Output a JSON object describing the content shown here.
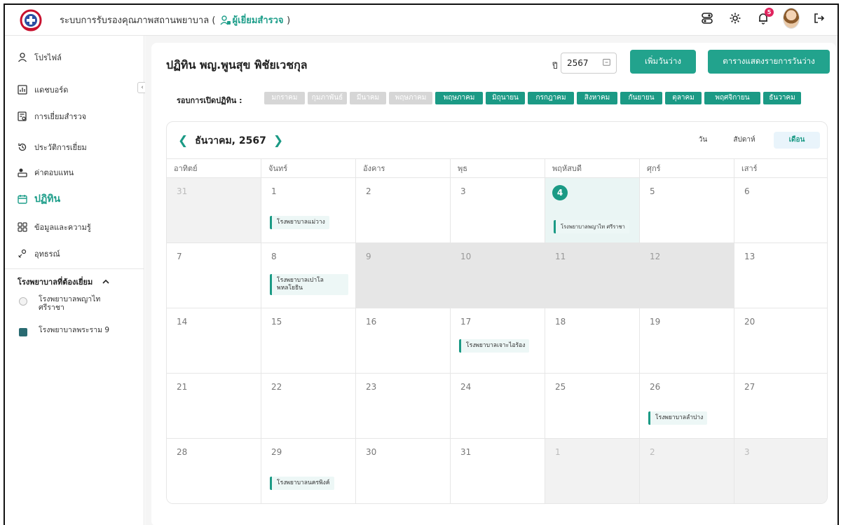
{
  "header": {
    "title": "ระบบการรับรองคุณภาพสถานพยาบาล (",
    "role": "ผู้เยี่ยมสำรวจ",
    "close_paren": ")",
    "notification_count": "5"
  },
  "sidebar": {
    "items": [
      {
        "label": "โปรไฟล์",
        "icon": "user-icon"
      },
      {
        "label": "แดชบอร์ด",
        "icon": "dashboard-icon"
      },
      {
        "label": "การเยี่ยมสำรวจ",
        "icon": "survey-icon"
      },
      {
        "label": "ประวัติการเยี่ยม",
        "icon": "history-icon"
      },
      {
        "label": "ค่าตอบแทน",
        "icon": "payment-icon"
      },
      {
        "label": "ปฏิทิน",
        "icon": "calendar-icon"
      },
      {
        "label": "ข้อมูลและความรู้",
        "icon": "grid-icon"
      },
      {
        "label": "อุทธรณ์",
        "icon": "appeal-icon"
      }
    ],
    "section_title": "โรงพยาบาลที่ต้องเยี่ยม",
    "hospitals": [
      {
        "name": "โรงพยาบาลพญาไท ศรีราชา"
      },
      {
        "name": "โรงพยาบาลพระราม 9"
      }
    ]
  },
  "main": {
    "title": "ปฏิทิน พญ.พูนสุข พิชัยเวชกุล",
    "year_label": "ปี",
    "year_value": "2567",
    "add_button": "เพิ่มวันว่าง",
    "table_button": "ตารางแสดงรายการวันว่าง",
    "round_label": "รอบการเปิดปฏิทิน :",
    "months": [
      {
        "label": "มกราคม",
        "active": false
      },
      {
        "label": "กุมภาพันธ์",
        "active": false
      },
      {
        "label": "มีนาคม",
        "active": false
      },
      {
        "label": "พฤษภาคม",
        "active": false
      },
      {
        "label": "พฤษภาคม",
        "active": true
      },
      {
        "label": "มิถุนายน",
        "active": true
      },
      {
        "label": "กรกฎาคม",
        "active": true
      },
      {
        "label": "สิงหาคม",
        "active": true
      },
      {
        "label": "กันยายน",
        "active": true
      },
      {
        "label": "ตุลาคม",
        "active": true
      },
      {
        "label": "พฤศจิกายน",
        "active": true
      },
      {
        "label": "ธันวาคม",
        "active": true
      }
    ]
  },
  "calendar": {
    "month_label": "ธันวาคม, 2567",
    "views": [
      "วัน",
      "สัปดาห์",
      "เดือน"
    ],
    "selected_view": "เดือน",
    "weekdays": [
      "อาทิตย์",
      "จันทร์",
      "อังคาร",
      "พุธ",
      "พฤหัสบดี",
      "ศุกร์",
      "เสาร์"
    ],
    "weeks": [
      [
        {
          "day": "31",
          "state": "muted"
        },
        {
          "day": "1",
          "event": "โรงพยาบาลแม่วาง"
        },
        {
          "day": "2"
        },
        {
          "day": "3"
        },
        {
          "day": "4",
          "state": "today",
          "event": "โรงพยาบาลพญาไท ศรีราชา"
        },
        {
          "day": "5"
        },
        {
          "day": "6"
        }
      ],
      [
        {
          "day": "7"
        },
        {
          "day": "8",
          "event": "โรงพยาบาลเปาโล พหลโยธิน"
        },
        {
          "day": "9",
          "state": "dark"
        },
        {
          "day": "10",
          "state": "dark"
        },
        {
          "day": "11",
          "state": "dark"
        },
        {
          "day": "12",
          "state": "dark"
        },
        {
          "day": "13"
        }
      ],
      [
        {
          "day": "14"
        },
        {
          "day": "15"
        },
        {
          "day": "16"
        },
        {
          "day": "17",
          "event": "โรงพยาบาลเจาะไอร้อง"
        },
        {
          "day": "18"
        },
        {
          "day": "19"
        },
        {
          "day": "20"
        }
      ],
      [
        {
          "day": "21"
        },
        {
          "day": "22"
        },
        {
          "day": "23"
        },
        {
          "day": "24"
        },
        {
          "day": "25"
        },
        {
          "day": "26",
          "event": "โรงพยาบาลลำปาง"
        },
        {
          "day": "27"
        }
      ],
      [
        {
          "day": "28"
        },
        {
          "day": "29",
          "event": "โรงพยาบาลนครพิงค์"
        },
        {
          "day": "30"
        },
        {
          "day": "31"
        },
        {
          "day": "1",
          "state": "muted"
        },
        {
          "day": "2",
          "state": "muted"
        },
        {
          "day": "3",
          "state": "muted"
        }
      ]
    ]
  },
  "colors": {
    "accent": "#1b9a85",
    "chip_inactive": "#d6d6d6",
    "today_bg": "#eaf5f4",
    "badge": "#e0245e"
  }
}
